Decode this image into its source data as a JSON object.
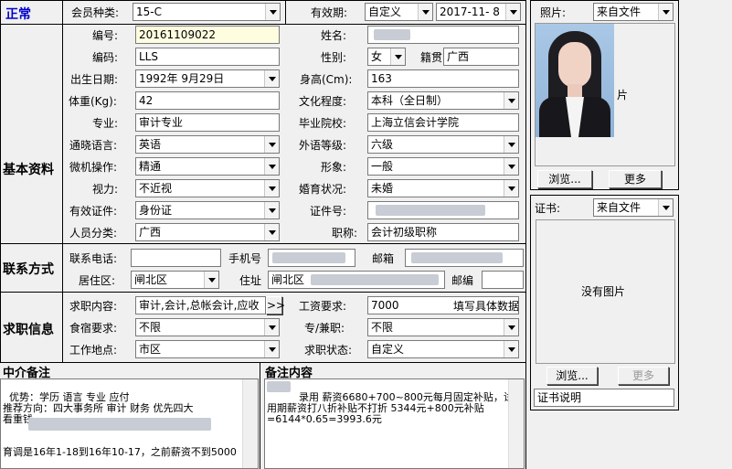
{
  "status": "正常",
  "sections": {
    "basic": "基本资料",
    "contact": "联系方式",
    "job": "求职信息"
  },
  "member_type": {
    "label": "会员种类:",
    "value": "15-C"
  },
  "validity": {
    "label": "有效期:",
    "mode": "自定义",
    "date": "2017-11- 8"
  },
  "id_no": {
    "label": "编号:",
    "value": "20161109022"
  },
  "name": {
    "label": "姓名:"
  },
  "code": {
    "label": "编码:",
    "value": "LLS"
  },
  "gender": {
    "label": "性别:",
    "value": "女"
  },
  "origin": {
    "label": "籍贯",
    "value": "广西"
  },
  "birth": {
    "label": "出生日期:",
    "value": "1992年 9月29日"
  },
  "height": {
    "label": "身高(Cm):",
    "value": "163"
  },
  "weight": {
    "label": "体重(Kg):",
    "value": "42"
  },
  "education": {
    "label": "文化程度:",
    "value": "本科（全日制）"
  },
  "major": {
    "label": "专业:",
    "value": "审计专业"
  },
  "school": {
    "label": "毕业院校:",
    "value": "上海立信会计学院"
  },
  "language": {
    "label": "通晓语言:",
    "value": "英语"
  },
  "foreign_level": {
    "label": "外语等级:",
    "value": "六级"
  },
  "computer": {
    "label": "微机操作:",
    "value": "精通"
  },
  "appearance": {
    "label": "形象:",
    "value": "一般"
  },
  "vision": {
    "label": "视力:",
    "value": "不近视"
  },
  "marriage": {
    "label": "婚育状况:",
    "value": "未婚"
  },
  "valid_doc": {
    "label": "有效证件:",
    "value": "身份证"
  },
  "doc_no": {
    "label": "证件号:"
  },
  "category": {
    "label": "人员分类:",
    "value": "广西"
  },
  "title_field": {
    "label": "职称:",
    "value": "会计初级职称"
  },
  "phone": {
    "label": "联系电话:",
    "value": ""
  },
  "mobile": {
    "label": "手机号"
  },
  "email": {
    "label": "邮箱"
  },
  "district": {
    "label": "居住区:",
    "value": "闸北区"
  },
  "address": {
    "label": "住址",
    "value": "闸北区"
  },
  "zip": {
    "label": "邮编",
    "value": ""
  },
  "job_content": {
    "label": "求职内容:",
    "value": "审计,会计,总帐会计,应收",
    "more": ">>"
  },
  "salary": {
    "label": "工资要求:",
    "value": "7000",
    "note": "填写具体数据"
  },
  "board": {
    "label": "食宿要求:",
    "value": "不限"
  },
  "fulltime": {
    "label": "专/兼职:",
    "value": "不限"
  },
  "workplace": {
    "label": "工作地点:",
    "value": "市区"
  },
  "job_status": {
    "label": "求职状态:",
    "value": "自定义"
  },
  "agent_note": {
    "title": "中介备注",
    "text": "优势：学历 语言 专业 应付\n推荐方向：四大事务所 审计 财务 优先四大\n看重钱\n\n\n育调是16年1-18到16年10-17，之前薪资不到5000"
  },
  "remark": {
    "title": "备注内容",
    "text": "        录用 薪资6680+700~800元每月固定补贴，试用期薪资打八折补贴不打折 5344元+800元补贴=6144*0.65=3993.6元"
  },
  "photo": {
    "label": "照片:",
    "source": "来自文件",
    "overlay": "片",
    "browse": "浏览...",
    "change": "更多"
  },
  "cert": {
    "label": "证书:",
    "source": "来自文件",
    "empty": "没有图片",
    "browse": "浏览...",
    "change": "更多",
    "desc": "证书说明"
  }
}
